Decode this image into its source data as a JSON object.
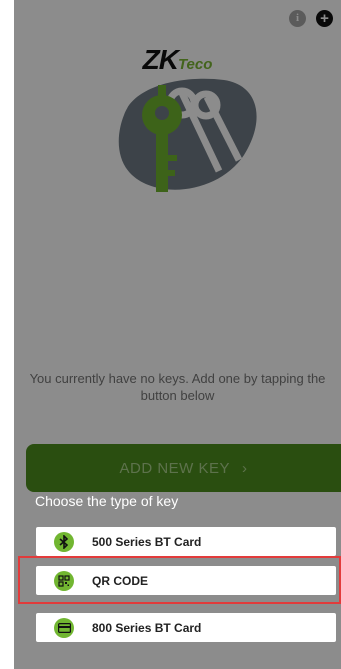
{
  "logo": {
    "brand": "ZK",
    "suffix": "Teco"
  },
  "message": "You currently have no keys. Add one by tapping the button below",
  "add_key_button": {
    "label": "ADD NEW KEY",
    "chevron": "›"
  },
  "key_type_sheet": {
    "title": "Choose the type of key",
    "options": [
      {
        "label": "500 Series BT Card",
        "icon": "bluetooth-icon"
      },
      {
        "label": "QR CODE",
        "icon": "qr-code-icon"
      },
      {
        "label": "800 Series BT Card",
        "icon": "card-icon"
      }
    ],
    "highlighted_option": "QR CODE"
  },
  "colors": {
    "accent_green": "#71b631",
    "button_green": "#4e8f1e",
    "highlight_red": "#e23b3b"
  }
}
